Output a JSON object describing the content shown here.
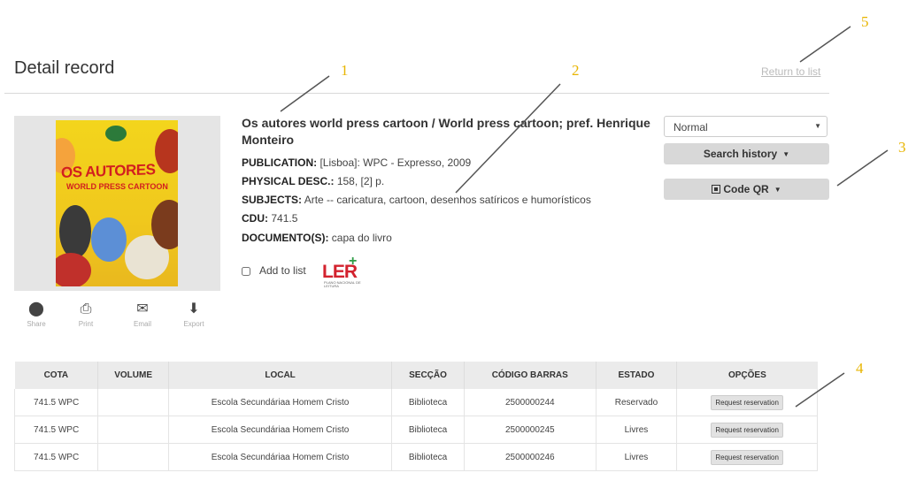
{
  "header": {
    "title": "Detail record",
    "return_link": "Return to list"
  },
  "record": {
    "title": "Os autores world press cartoon / World press cartoon; pref. Henrique Monteiro",
    "fields": [
      {
        "label": "PUBLICATION:",
        "value": "[Lisboa]: WPC - Expresso, 2009"
      },
      {
        "label": "PHYSICAL DESC.:",
        "value": "158, [2] p."
      },
      {
        "label": "SUBJECTS:",
        "value": "Arte -- caricatura, cartoon, desenhos satíricos e humorísticos"
      },
      {
        "label": "CDU:",
        "value": "741.5"
      },
      {
        "label": "DOCUMENTO(S):",
        "value": "capa do livro"
      }
    ],
    "add_to_list": "Add to list",
    "ler_logo": {
      "main": "LER",
      "plus": "+",
      "small": "PLANO NACIONAL DE LEITURA"
    },
    "cover": {
      "title": "OS AUTORES",
      "subtitle": "WORLD PRESS CARTOON"
    }
  },
  "actions": {
    "share": "Share",
    "print": "Print",
    "email": "Email",
    "export": "Export"
  },
  "sidebar": {
    "format_select": "Normal",
    "search_history": "Search history",
    "code_qr": "Code QR"
  },
  "table": {
    "headers": [
      "COTA",
      "VOLUME",
      "LOCAL",
      "SECÇÃO",
      "CÓDIGO BARRAS",
      "ESTADO",
      "OPÇÕES"
    ],
    "rows": [
      {
        "cota": "741.5 WPC",
        "volume": "",
        "local": "Escola Secundáriaa Homem Cristo",
        "seccao": "Biblioteca",
        "codigo": "2500000244",
        "estado": "Reservado",
        "opcao": "Request reservation"
      },
      {
        "cota": "741.5 WPC",
        "volume": "",
        "local": "Escola Secundáriaa Homem Cristo",
        "seccao": "Biblioteca",
        "codigo": "2500000245",
        "estado": "Livres",
        "opcao": "Request reservation"
      },
      {
        "cota": "741.5 WPC",
        "volume": "",
        "local": "Escola Secundáriaa Homem Cristo",
        "seccao": "Biblioteca",
        "codigo": "2500000246",
        "estado": "Livres",
        "opcao": "Request reservation"
      }
    ]
  },
  "annotations": [
    "1",
    "2",
    "3",
    "4",
    "5"
  ],
  "colors": {
    "annotation": "#e8b500",
    "ler_red": "#d3222e",
    "ler_green": "#2f9d46",
    "button_gray": "#d8d8d8"
  }
}
